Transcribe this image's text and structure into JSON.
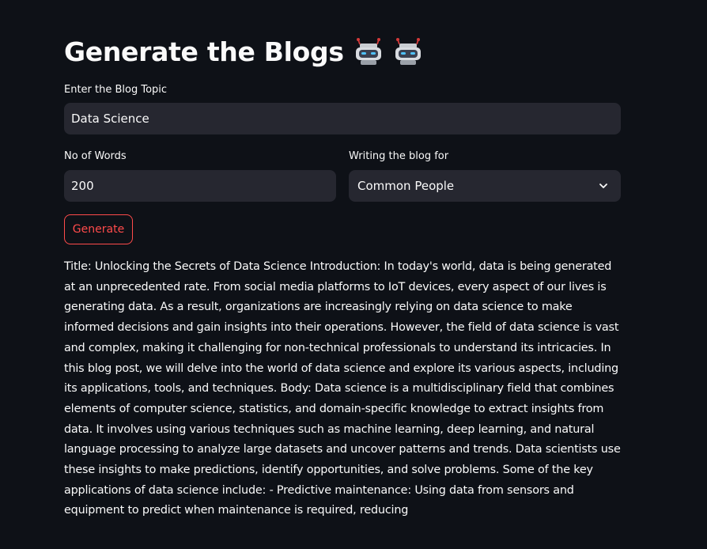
{
  "header": {
    "title": "Generate the Blogs",
    "icons": [
      "robot-icon",
      "robot-icon"
    ]
  },
  "form": {
    "topic_label": "Enter the Blog Topic",
    "topic_value": "Data Science",
    "words_label": "No of Words",
    "words_value": "200",
    "audience_label": "Writing the blog for",
    "audience_value": "Common People",
    "generate_label": "Generate"
  },
  "output": {
    "text": "Title: Unlocking the Secrets of Data Science Introduction: In today's world, data is being generated at an unprecedented rate. From social media platforms to IoT devices, every aspect of our lives is generating data. As a result, organizations are increasingly relying on data science to make informed decisions and gain insights into their operations. However, the field of data science is vast and complex, making it challenging for non-technical professionals to understand its intricacies. In this blog post, we will delve into the world of data science and explore its various aspects, including its applications, tools, and techniques. Body: Data science is a multidisciplinary field that combines elements of computer science, statistics, and domain-specific knowledge to extract insights from data. It involves using various techniques such as machine learning, deep learning, and natural language processing to analyze large datasets and uncover patterns and trends. Data scientists use these insights to make predictions, identify opportunities, and solve problems. Some of the key applications of data science include: - Predictive maintenance: Using data from sensors and equipment to predict when maintenance is required, reducing"
  },
  "colors": {
    "background": "#0e1117",
    "input_bg": "#262730",
    "text": "#fafafa",
    "accent": "#ff4b4b"
  }
}
